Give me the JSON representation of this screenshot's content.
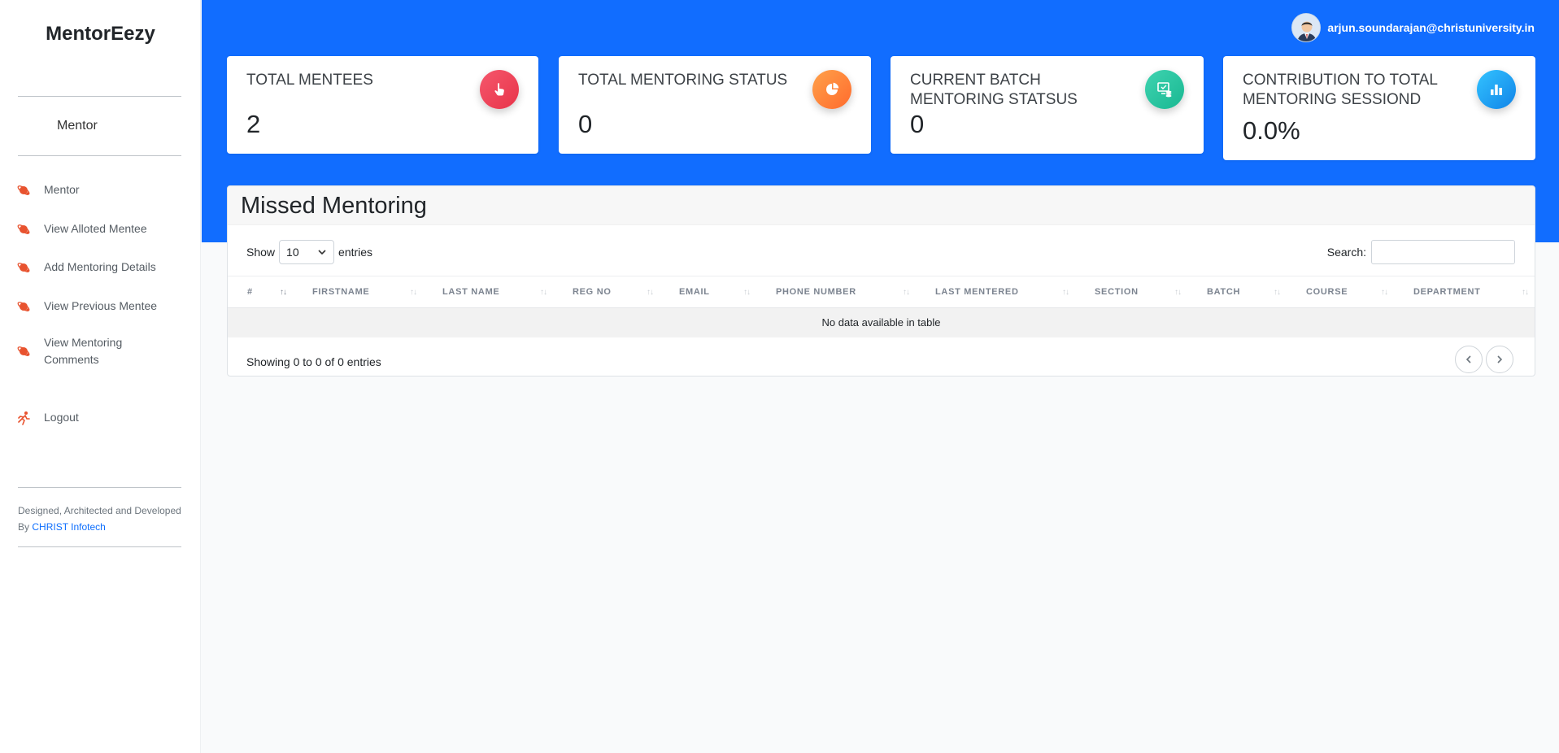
{
  "brand": "MentorEezy",
  "role": "Mentor",
  "nav": [
    {
      "label": "Mentor",
      "icon": "orbit-icon"
    },
    {
      "label": "View Alloted Mentee",
      "icon": "orbit-icon"
    },
    {
      "label": "Add Mentoring Details",
      "icon": "orbit-icon"
    },
    {
      "label": "View Previous Mentee",
      "icon": "orbit-icon"
    },
    {
      "label": "View Mentoring Comments",
      "icon": "orbit-icon"
    },
    {
      "label": "Logout",
      "icon": "running-person-icon"
    }
  ],
  "footer": {
    "text": "Designed, Architected and Developed By",
    "link": "CHRIST Infotech"
  },
  "user": {
    "email": "arjun.soundarajan@christuniversity.in",
    "avatar_icon": "user-avatar"
  },
  "stats": [
    {
      "title": "TOTAL MENTEES",
      "value": "2",
      "icon": "hand-pointer-icon",
      "color": "#e8344a"
    },
    {
      "title": "TOTAL MENTORING STATUS",
      "value": "0",
      "icon": "pie-chart-icon",
      "color": "#ff7b2d"
    },
    {
      "title": "CURRENT BATCH MENTORING STATSUS",
      "value": "0",
      "icon": "monitor-coins-icon",
      "color": "#27c7a0"
    },
    {
      "title": "CONTRIBUTION TO TOTAL MENTORING SESSIOND",
      "value": "0.0%",
      "icon": "bar-chart-icon",
      "color": "#19a2f0"
    }
  ],
  "table": {
    "title": "Missed Mentoring",
    "show_label": "Show",
    "page_size": "10",
    "entries_label": "entries",
    "search_label": "Search:",
    "columns": [
      "#",
      "FIRSTNAME",
      "LAST NAME",
      "REG NO",
      "EMAIL",
      "PHONE NUMBER",
      "LAST MENTERED",
      "SECTION",
      "BATCH",
      "COURSE",
      "DEPARTMENT"
    ],
    "empty_text": "No data available in table",
    "info": "Showing 0 to 0 of 0 entries"
  },
  "colors": {
    "header": "#116dff",
    "accent_link": "#0d6efd",
    "nav_icon": "#e8532f"
  }
}
